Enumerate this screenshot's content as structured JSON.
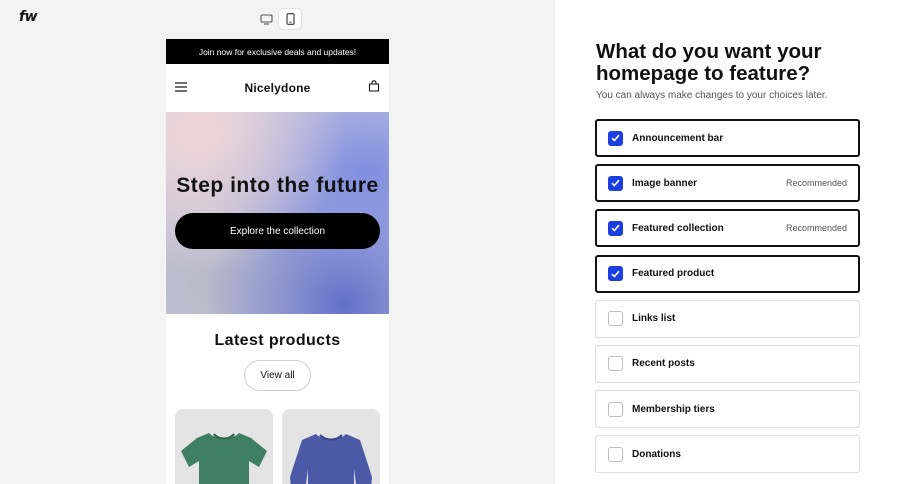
{
  "app": {
    "logo_text": "fw",
    "device_toggle": {
      "icons": [
        "desktop-icon",
        "mobile-icon"
      ],
      "active": "mobile"
    }
  },
  "preview": {
    "announcement": "Join now for exclusive deals and updates!",
    "store_name": "Nicelydone",
    "hero_title": "Step into the future",
    "hero_button": "Explore the collection",
    "latest_title": "Latest products",
    "view_all": "View all",
    "products": [
      {
        "icon": "green-tshirt-icon",
        "color": "#3f7f63"
      },
      {
        "icon": "blue-sweatshirt-icon",
        "color": "#4a5aa6"
      }
    ]
  },
  "panel": {
    "heading": "What do you want your homepage to feature?",
    "subtext": "You can always make changes to your choices later.",
    "options": [
      {
        "label": "Announcement bar",
        "checked": true,
        "tag": ""
      },
      {
        "label": "Image banner",
        "checked": true,
        "tag": "Recommended"
      },
      {
        "label": "Featured collection",
        "checked": true,
        "tag": "Recommended"
      },
      {
        "label": "Featured product",
        "checked": true,
        "tag": ""
      },
      {
        "label": "Links list",
        "checked": false,
        "tag": ""
      },
      {
        "label": "Recent posts",
        "checked": false,
        "tag": ""
      },
      {
        "label": "Membership tiers",
        "checked": false,
        "tag": ""
      },
      {
        "label": "Donations",
        "checked": false,
        "tag": ""
      }
    ]
  },
  "colors": {
    "accent": "#1a3ee0",
    "dark": "#111111",
    "pane_bg": "#f3f3f3"
  }
}
